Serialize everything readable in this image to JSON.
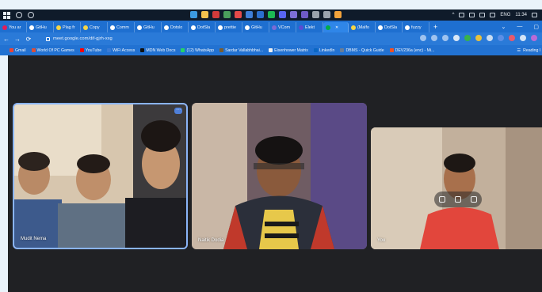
{
  "taskbar": {
    "time": "11:34",
    "lang": "ENG"
  },
  "tabs": [
    {
      "label": "You ar",
      "icon": "slack-icon"
    },
    {
      "label": "GitHu",
      "icon": "github-icon"
    },
    {
      "label": "Plag fr",
      "icon": "plag-icon"
    },
    {
      "label": "Copy",
      "icon": "copy-icon"
    },
    {
      "label": "Comm",
      "icon": "github-icon"
    },
    {
      "label": "GitHu",
      "icon": "github-icon"
    },
    {
      "label": "Dotslo",
      "icon": "dotslash-icon"
    },
    {
      "label": "DotSla",
      "icon": "dotslash-icon"
    },
    {
      "label": "prettie",
      "icon": "github-icon"
    },
    {
      "label": "GitHu",
      "icon": "github-icon"
    },
    {
      "label": "VCom",
      "icon": "vcom-icon"
    },
    {
      "label": "Elekt",
      "icon": "elekt-icon"
    },
    {
      "label": "",
      "icon": "meet-icon",
      "active": true
    },
    {
      "label": "(Malfo",
      "icon": "malfo-icon"
    },
    {
      "label": "DotSla",
      "icon": "dotslash-icon"
    },
    {
      "label": "fuzzy",
      "icon": "google-icon"
    }
  ],
  "address": {
    "url": "meet.google.com/dif-gjrh-xxg"
  },
  "bookmarks": [
    {
      "label": "Gmail",
      "color": "#ea4335"
    },
    {
      "label": "World Of PC Games",
      "color": "#d94f3b"
    },
    {
      "label": "YouTube",
      "color": "#ff0000"
    },
    {
      "label": "WiFi Access",
      "color": "#3a7bd5"
    },
    {
      "label": "MDN Web Docs",
      "color": "#111111"
    },
    {
      "label": "(12) WhatsApp",
      "color": "#25d366"
    },
    {
      "label": "Sardar Vallabhbhai...",
      "color": "#7a5c2e"
    },
    {
      "label": "Eisenhower Matrix",
      "color": "#f0f0f0"
    },
    {
      "label": "LinkedIn",
      "color": "#0a66c2"
    },
    {
      "label": "DBMS - Quick Guide",
      "color": "#6a7d96"
    },
    {
      "label": "DEV236a (enc) - Mi...",
      "color": "#f25022"
    }
  ],
  "reading_list": "Reading l",
  "participants": [
    {
      "name": "Mudit Nema",
      "speaking": true
    },
    {
      "name": "Naitik Dodia",
      "speaking": false
    },
    {
      "name": "You",
      "speaking": false
    }
  ],
  "colors": {
    "browser_blue": "#1e6fd0",
    "meet_bg": "#202124",
    "speaking_border": "#8ab4f8"
  }
}
